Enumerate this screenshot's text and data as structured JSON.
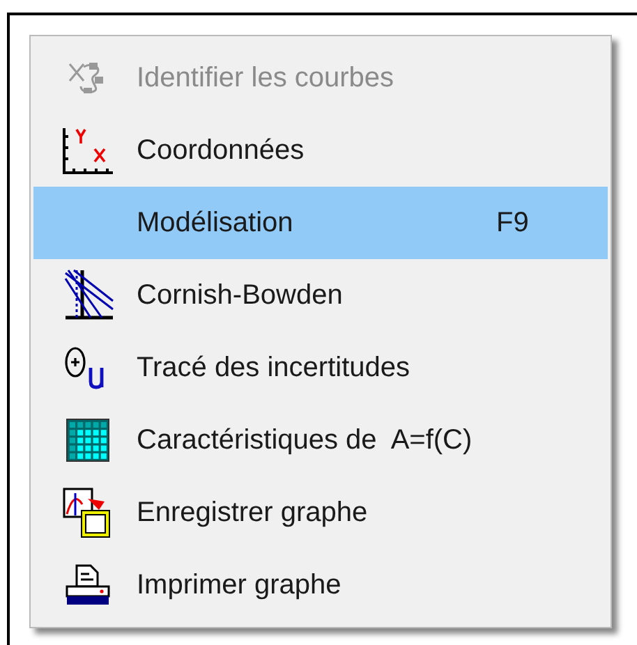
{
  "menu": {
    "items": [
      {
        "kind": "curves",
        "label": "Identifier les courbes",
        "disabled": true,
        "selected": false
      },
      {
        "kind": "coords",
        "label": "Coordonnées",
        "disabled": false,
        "selected": false
      },
      {
        "kind": "none",
        "label": "Modélisation",
        "shortcut": "F9",
        "disabled": false,
        "selected": true
      },
      {
        "kind": "cornish",
        "label": "Cornish-Bowden",
        "disabled": false,
        "selected": false
      },
      {
        "kind": "theta",
        "label": "Tracé des incertitudes",
        "disabled": false,
        "selected": false
      },
      {
        "kind": "grid",
        "label": "Caractéristiques de  A=f(C)",
        "disabled": false,
        "selected": false
      },
      {
        "kind": "save",
        "label": "Enregistrer graphe",
        "disabled": false,
        "selected": false
      },
      {
        "kind": "print",
        "label": "Imprimer graphe",
        "disabled": false,
        "selected": false
      }
    ]
  }
}
